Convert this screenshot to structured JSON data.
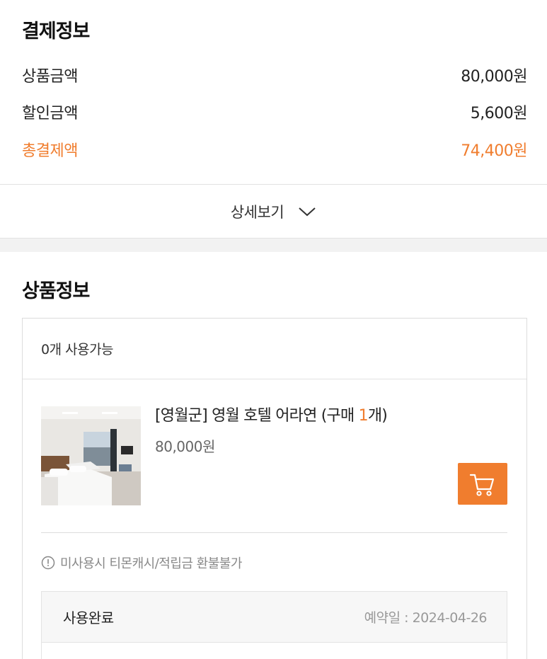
{
  "payment": {
    "title": "결제정보",
    "rows": [
      {
        "label": "상품금액",
        "value": "80,000원"
      },
      {
        "label": "할인금액",
        "value": "5,600원"
      }
    ],
    "total": {
      "label": "총결제액",
      "value": "74,400원"
    },
    "detail_label": "상세보기"
  },
  "product": {
    "title": "상품정보",
    "available": "0개 사용가능",
    "name_prefix": "[영월군] 영월 호텔 어라연 (구매 ",
    "qty": "1",
    "name_suffix": "개)",
    "price": "80,000원",
    "notice": "미사용시 티몬캐시/적립금 환불불가",
    "status": "사용완료",
    "reservation": "예약일 : 2024-04-26"
  },
  "colors": {
    "accent": "#f07d2e"
  },
  "icons": {
    "detail": "chevron-down-icon",
    "cart": "cart-icon",
    "notice": "info-circle-icon"
  }
}
